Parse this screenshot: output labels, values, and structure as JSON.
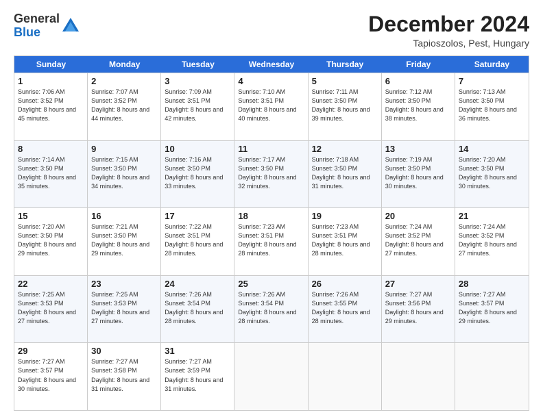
{
  "logo": {
    "line1": "General",
    "line2": "Blue"
  },
  "title": "December 2024",
  "subtitle": "Tapioszolos, Pest, Hungary",
  "days_of_week": [
    "Sunday",
    "Monday",
    "Tuesday",
    "Wednesday",
    "Thursday",
    "Friday",
    "Saturday"
  ],
  "weeks": [
    [
      {
        "day": "1",
        "sunrise": "Sunrise: 7:06 AM",
        "sunset": "Sunset: 3:52 PM",
        "daylight": "Daylight: 8 hours and 45 minutes."
      },
      {
        "day": "2",
        "sunrise": "Sunrise: 7:07 AM",
        "sunset": "Sunset: 3:52 PM",
        "daylight": "Daylight: 8 hours and 44 minutes."
      },
      {
        "day": "3",
        "sunrise": "Sunrise: 7:09 AM",
        "sunset": "Sunset: 3:51 PM",
        "daylight": "Daylight: 8 hours and 42 minutes."
      },
      {
        "day": "4",
        "sunrise": "Sunrise: 7:10 AM",
        "sunset": "Sunset: 3:51 PM",
        "daylight": "Daylight: 8 hours and 40 minutes."
      },
      {
        "day": "5",
        "sunrise": "Sunrise: 7:11 AM",
        "sunset": "Sunset: 3:50 PM",
        "daylight": "Daylight: 8 hours and 39 minutes."
      },
      {
        "day": "6",
        "sunrise": "Sunrise: 7:12 AM",
        "sunset": "Sunset: 3:50 PM",
        "daylight": "Daylight: 8 hours and 38 minutes."
      },
      {
        "day": "7",
        "sunrise": "Sunrise: 7:13 AM",
        "sunset": "Sunset: 3:50 PM",
        "daylight": "Daylight: 8 hours and 36 minutes."
      }
    ],
    [
      {
        "day": "8",
        "sunrise": "Sunrise: 7:14 AM",
        "sunset": "Sunset: 3:50 PM",
        "daylight": "Daylight: 8 hours and 35 minutes."
      },
      {
        "day": "9",
        "sunrise": "Sunrise: 7:15 AM",
        "sunset": "Sunset: 3:50 PM",
        "daylight": "Daylight: 8 hours and 34 minutes."
      },
      {
        "day": "10",
        "sunrise": "Sunrise: 7:16 AM",
        "sunset": "Sunset: 3:50 PM",
        "daylight": "Daylight: 8 hours and 33 minutes."
      },
      {
        "day": "11",
        "sunrise": "Sunrise: 7:17 AM",
        "sunset": "Sunset: 3:50 PM",
        "daylight": "Daylight: 8 hours and 32 minutes."
      },
      {
        "day": "12",
        "sunrise": "Sunrise: 7:18 AM",
        "sunset": "Sunset: 3:50 PM",
        "daylight": "Daylight: 8 hours and 31 minutes."
      },
      {
        "day": "13",
        "sunrise": "Sunrise: 7:19 AM",
        "sunset": "Sunset: 3:50 PM",
        "daylight": "Daylight: 8 hours and 30 minutes."
      },
      {
        "day": "14",
        "sunrise": "Sunrise: 7:20 AM",
        "sunset": "Sunset: 3:50 PM",
        "daylight": "Daylight: 8 hours and 30 minutes."
      }
    ],
    [
      {
        "day": "15",
        "sunrise": "Sunrise: 7:20 AM",
        "sunset": "Sunset: 3:50 PM",
        "daylight": "Daylight: 8 hours and 29 minutes."
      },
      {
        "day": "16",
        "sunrise": "Sunrise: 7:21 AM",
        "sunset": "Sunset: 3:50 PM",
        "daylight": "Daylight: 8 hours and 29 minutes."
      },
      {
        "day": "17",
        "sunrise": "Sunrise: 7:22 AM",
        "sunset": "Sunset: 3:51 PM",
        "daylight": "Daylight: 8 hours and 28 minutes."
      },
      {
        "day": "18",
        "sunrise": "Sunrise: 7:23 AM",
        "sunset": "Sunset: 3:51 PM",
        "daylight": "Daylight: 8 hours and 28 minutes."
      },
      {
        "day": "19",
        "sunrise": "Sunrise: 7:23 AM",
        "sunset": "Sunset: 3:51 PM",
        "daylight": "Daylight: 8 hours and 28 minutes."
      },
      {
        "day": "20",
        "sunrise": "Sunrise: 7:24 AM",
        "sunset": "Sunset: 3:52 PM",
        "daylight": "Daylight: 8 hours and 27 minutes."
      },
      {
        "day": "21",
        "sunrise": "Sunrise: 7:24 AM",
        "sunset": "Sunset: 3:52 PM",
        "daylight": "Daylight: 8 hours and 27 minutes."
      }
    ],
    [
      {
        "day": "22",
        "sunrise": "Sunrise: 7:25 AM",
        "sunset": "Sunset: 3:53 PM",
        "daylight": "Daylight: 8 hours and 27 minutes."
      },
      {
        "day": "23",
        "sunrise": "Sunrise: 7:25 AM",
        "sunset": "Sunset: 3:53 PM",
        "daylight": "Daylight: 8 hours and 27 minutes."
      },
      {
        "day": "24",
        "sunrise": "Sunrise: 7:26 AM",
        "sunset": "Sunset: 3:54 PM",
        "daylight": "Daylight: 8 hours and 28 minutes."
      },
      {
        "day": "25",
        "sunrise": "Sunrise: 7:26 AM",
        "sunset": "Sunset: 3:54 PM",
        "daylight": "Daylight: 8 hours and 28 minutes."
      },
      {
        "day": "26",
        "sunrise": "Sunrise: 7:26 AM",
        "sunset": "Sunset: 3:55 PM",
        "daylight": "Daylight: 8 hours and 28 minutes."
      },
      {
        "day": "27",
        "sunrise": "Sunrise: 7:27 AM",
        "sunset": "Sunset: 3:56 PM",
        "daylight": "Daylight: 8 hours and 29 minutes."
      },
      {
        "day": "28",
        "sunrise": "Sunrise: 7:27 AM",
        "sunset": "Sunset: 3:57 PM",
        "daylight": "Daylight: 8 hours and 29 minutes."
      }
    ],
    [
      {
        "day": "29",
        "sunrise": "Sunrise: 7:27 AM",
        "sunset": "Sunset: 3:57 PM",
        "daylight": "Daylight: 8 hours and 30 minutes."
      },
      {
        "day": "30",
        "sunrise": "Sunrise: 7:27 AM",
        "sunset": "Sunset: 3:58 PM",
        "daylight": "Daylight: 8 hours and 31 minutes."
      },
      {
        "day": "31",
        "sunrise": "Sunrise: 7:27 AM",
        "sunset": "Sunset: 3:59 PM",
        "daylight": "Daylight: 8 hours and 31 minutes."
      },
      null,
      null,
      null,
      null
    ]
  ]
}
